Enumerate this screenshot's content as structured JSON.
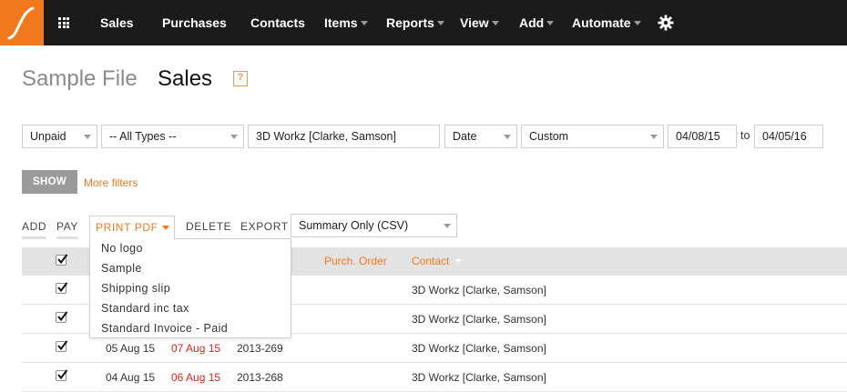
{
  "nav": {
    "items": [
      {
        "label": "Sales",
        "caret": false
      },
      {
        "label": "Purchases",
        "caret": false
      },
      {
        "label": "Contacts",
        "caret": false
      },
      {
        "label": "Items",
        "caret": true
      },
      {
        "label": "Reports",
        "caret": true
      },
      {
        "label": "View",
        "caret": true
      },
      {
        "label": "Add",
        "caret": true
      },
      {
        "label": "Automate",
        "caret": true
      }
    ],
    "icons": [
      "logo-icon",
      "apps-grid-icon",
      "gear-icon"
    ]
  },
  "header": {
    "file_name": "Sample File",
    "page_title": "Sales",
    "help_label": "?"
  },
  "filters": {
    "status": "Unpaid",
    "type": "-- All Types --",
    "contact": "3D Workz [Clarke, Samson]",
    "date_field": "Date",
    "range": "Custom",
    "from_date": "04/08/15",
    "to_label": "to",
    "to_date": "04/05/16",
    "show_label": "SHOW",
    "more_filters_label": "More filters"
  },
  "actions": {
    "add": "ADD",
    "pay": "PAY",
    "print_pdf": "PRINT PDF",
    "delete": "DELETE",
    "export": "EXPORT",
    "export_format": "Summary Only (CSV)"
  },
  "print_menu": {
    "items": [
      "No logo",
      "Sample",
      "Shipping slip",
      "Standard inc tax",
      "Standard Invoice - Paid"
    ]
  },
  "table": {
    "headers": {
      "purch_order": "Purch. Order",
      "contact": "Contact"
    },
    "rows": [
      {
        "date": "",
        "due": "",
        "number": "",
        "contact": "3D Workz [Clarke, Samson]",
        "checked": true
      },
      {
        "date": "",
        "due": "",
        "number": "",
        "contact": "3D Workz [Clarke, Samson]",
        "checked": true
      },
      {
        "date": "05 Aug 15",
        "due": "07 Aug 15",
        "number": "2013-269",
        "contact": "3D Workz [Clarke, Samson]",
        "checked": true
      },
      {
        "date": "04 Aug 15",
        "due": "06 Aug 15",
        "number": "2013-268",
        "contact": "3D Workz [Clarke, Samson]",
        "checked": true
      }
    ]
  },
  "colors": {
    "accent": "#f2781e",
    "nav_bg": "#1b1b1b",
    "overdue": "#d9261c"
  }
}
